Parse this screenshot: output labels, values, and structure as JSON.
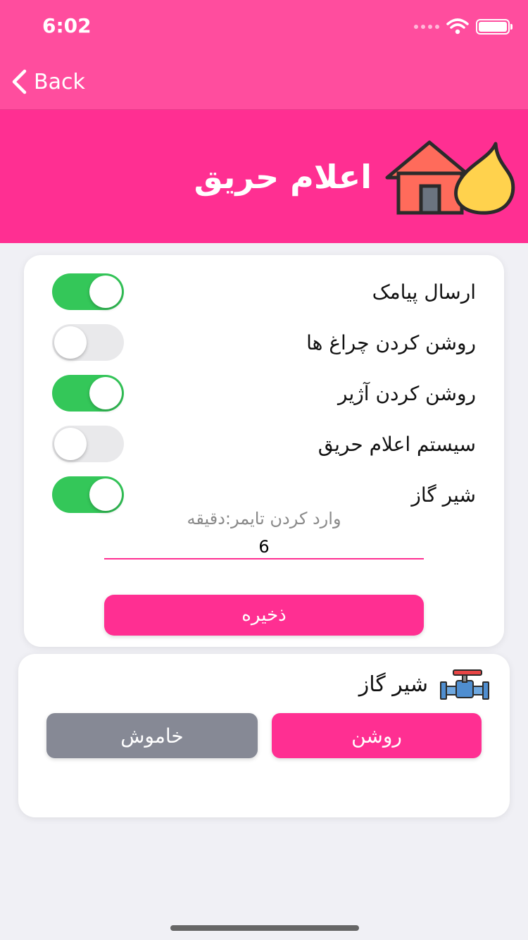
{
  "status_bar": {
    "time": "6:02"
  },
  "nav": {
    "back_label": "Back"
  },
  "header": {
    "title": "اعلام حریق",
    "icon": "house-fire-icon"
  },
  "settings": {
    "items": [
      {
        "label": "ارسال پیامک",
        "on": true
      },
      {
        "label": "روشن کردن چراغ ها",
        "on": false
      },
      {
        "label": "روشن کردن آژیر",
        "on": true
      },
      {
        "label": "سیستم اعلام حریق",
        "on": false
      },
      {
        "label": "شیر گاز",
        "on": true
      }
    ],
    "timer_label": "وارد کردن تایمر:دقیقه",
    "timer_value": "6",
    "save_label": "ذخیره"
  },
  "gas_valve": {
    "title": "شیر گاز",
    "icon": "gas-valve-icon",
    "on_label": "روشن",
    "off_label": "خاموش"
  },
  "colors": {
    "nav_bar": "#ff4d9e",
    "banner": "#ff2f92",
    "toggle_on": "#34c759",
    "toggle_off": "#e9e9eb",
    "off_button": "#868995"
  }
}
